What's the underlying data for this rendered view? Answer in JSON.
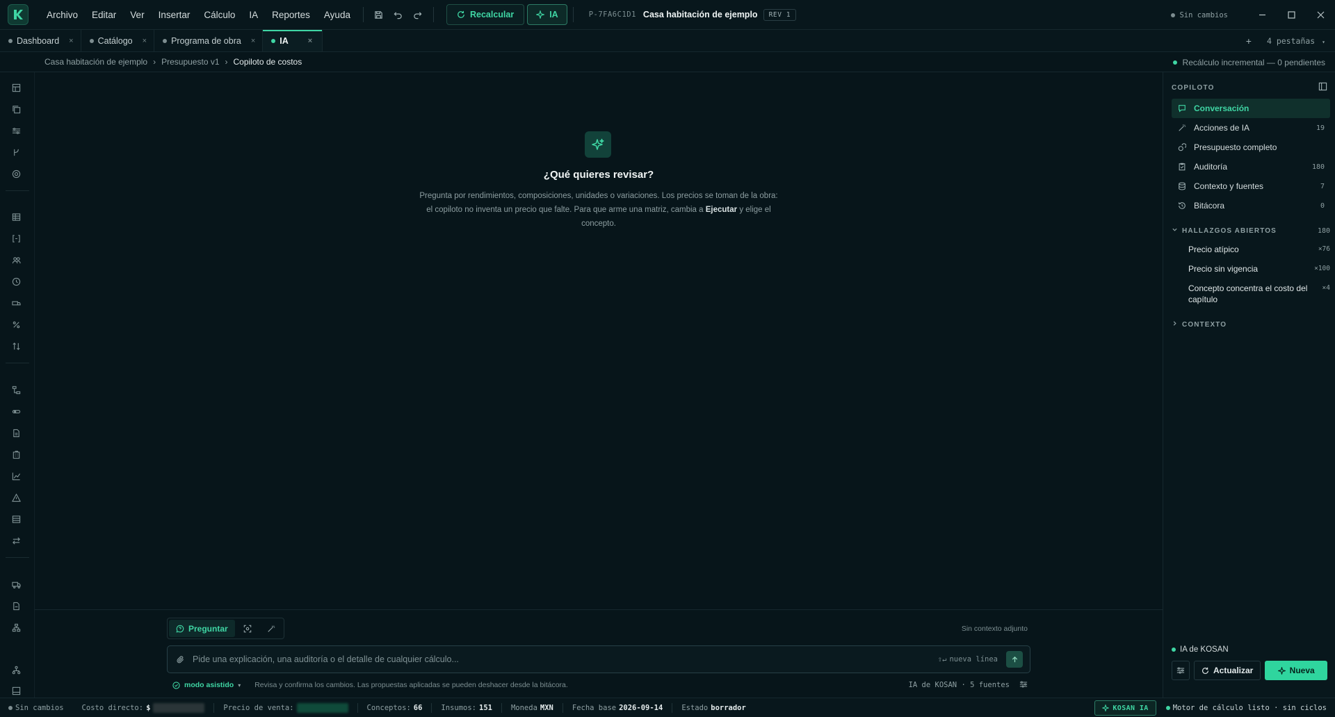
{
  "app": {
    "menus": [
      "Archivo",
      "Editar",
      "Ver",
      "Insertar",
      "Cálculo",
      "IA",
      "Reportes",
      "Ayuda"
    ],
    "recalc_label": "Recalcular",
    "ia_label": "IA",
    "project_code": "P-7FA6C1D1",
    "project_title": "Casa habitación de ejemplo",
    "rev": "REV 1",
    "save_status": "Sin cambios"
  },
  "tabs": {
    "items": [
      {
        "label": "Dashboard"
      },
      {
        "label": "Catálogo"
      },
      {
        "label": "Programa de obra"
      },
      {
        "label": "IA"
      }
    ],
    "count_label": "4 pestañas",
    "add": "+"
  },
  "breadcrumb": {
    "items": [
      "Casa habitación de ejemplo",
      "Presupuesto v1",
      "Copiloto de costos"
    ],
    "sep": "›",
    "recalc_status": "Recálculo incremental — 0 pendientes"
  },
  "hero": {
    "title": "¿Qué quieres revisar?",
    "desc_part1": "Pregunta por rendimientos, composiciones, unidades o variaciones. Los precios se toman de la obra: el copiloto no inventa un precio que falte. Para que arme una matriz, cambia a ",
    "desc_bold": "Ejecutar",
    "desc_part2": " y elige el concepto."
  },
  "composer": {
    "mode_ask": "Preguntar",
    "no_context": "Sin contexto adjunto",
    "placeholder": "Pide una explicación, una auditoría o el detalle de cualquier cálculo...",
    "newline_hint": "nueva línea",
    "assist_mode": "modo asistido",
    "assist_note": "Revisa y confirma los cambios. Las propuestas aplicadas se pueden deshacer desde la bitácora.",
    "sources": "IA de KOSAN · 5 fuentes"
  },
  "panel": {
    "title": "COPILOTO",
    "nav": [
      {
        "label": "Conversación",
        "count": ""
      },
      {
        "label": "Acciones de IA",
        "count": "19"
      },
      {
        "label": "Presupuesto completo",
        "count": ""
      },
      {
        "label": "Auditoría",
        "count": "180"
      },
      {
        "label": "Contexto y fuentes",
        "count": "7"
      },
      {
        "label": "Bitácora",
        "count": "0"
      }
    ],
    "findings_title": "HALLAZGOS ABIERTOS",
    "findings_count": "180",
    "findings": [
      {
        "label": "Precio atípico",
        "count": "×76"
      },
      {
        "label": "Precio sin vigencia",
        "count": "×100"
      },
      {
        "label": "Concepto concentra el costo del capítulo",
        "count": "×4"
      }
    ],
    "context_title": "CONTEXTO",
    "ia_label": "IA de KOSAN",
    "update_label": "Actualizar",
    "new_label": "Nueva"
  },
  "statusbar": {
    "save_status": "Sin cambios",
    "direct_cost_label": "Costo directo:",
    "direct_cost_prefix": "$",
    "sale_price_label": "Precio de venta:",
    "concepts_label": "Conceptos:",
    "concepts": "66",
    "inputs_label": "Insumos:",
    "inputs": "151",
    "currency_label": "Moneda",
    "currency": "MXN",
    "base_date_label": "Fecha base",
    "base_date": "2026-09-14",
    "state_label": "Estado",
    "state": "borrador",
    "kosan_ia": "KOSAN IA",
    "engine_status": "Motor de cálculo listo · sin ciclos"
  },
  "colors": {
    "accent": "#3fd6a4",
    "background": "#07151a",
    "panel": "#08171c"
  }
}
